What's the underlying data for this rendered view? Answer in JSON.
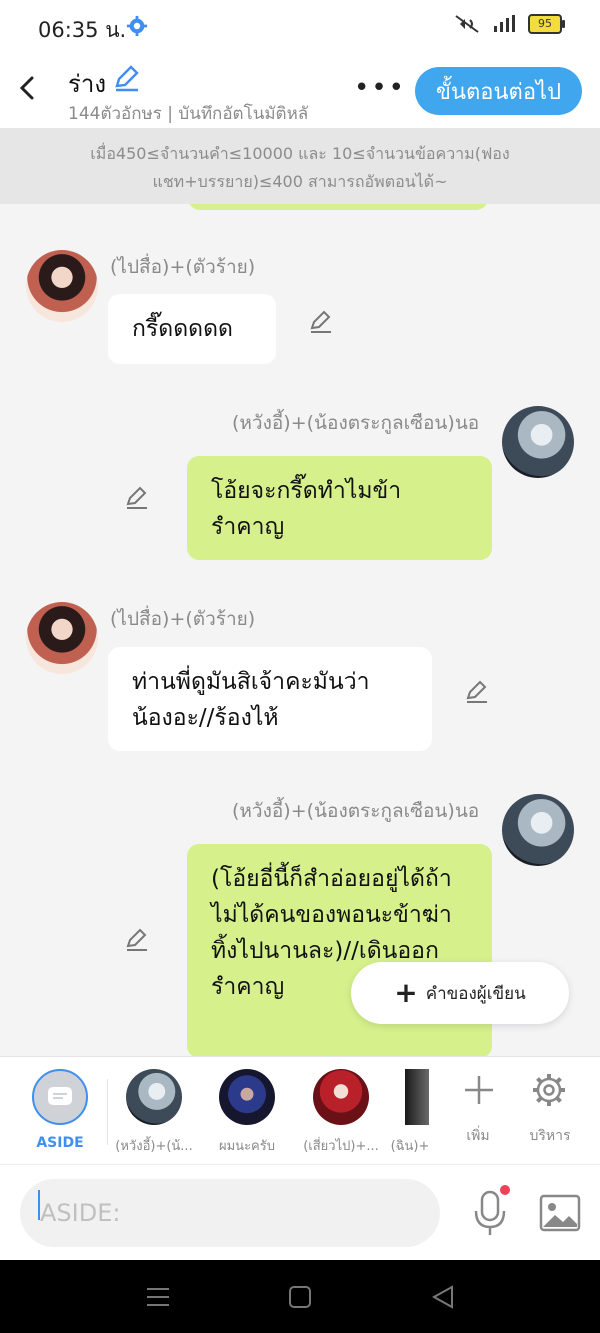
{
  "status": {
    "time": "06:35 น.",
    "battery": "95"
  },
  "header": {
    "title": "ร่าง",
    "subtitle": "144ตัวอักษร | บันทึกอัตโนมัติหลั",
    "next_label": "ขั้นตอนต่อไป"
  },
  "notice": {
    "line1": "เมื่อ450≤จำนวนคำ≤10000 และ 10≤จำนวนข้อความ(ฟอง",
    "line2": "แชท+บรรยาย)≤400 สามารถอัพตอนได้~"
  },
  "messages": [
    {
      "side": "left",
      "name": "(ไปสื่อ)+(ตัวร้าย)",
      "text": "กรี๊ดดดดด"
    },
    {
      "side": "right",
      "name": "(หวังอี้)+(น้องตระกูลเซือน)นอ",
      "text": "โอ้ยจะกรี๊ดทำไมข้ารำคาญ"
    },
    {
      "side": "left",
      "name": "(ไปสื่อ)+(ตัวร้าย)",
      "text": "ท่านพี่ดูมันสิเจ้าคะมันว่าน้องอะ//ร้องไห้"
    },
    {
      "side": "right",
      "name": "(หวังอี้)+(น้องตระกูลเซือน)นอ",
      "text": "(โอ้ยอี่นี้ก็สำอ่อยอยู่ได้ถ้าไม่ได้คนของพอนะข้าฆ่าทิ้งไปนานละ)//เดินออกรำคาญ"
    }
  ],
  "author_note": {
    "label": "คำของผู้เขียน"
  },
  "characters": {
    "aside": "ASIDE",
    "items": [
      "(หวังอี้)+(น้...",
      "ผมนะครับ",
      "(เสี่ยวไป)+...",
      "(ฉิน)+"
    ],
    "add_label": "เพิ่ม",
    "manage_label": "บริหาร"
  },
  "input": {
    "placeholder": "ASIDE:"
  }
}
